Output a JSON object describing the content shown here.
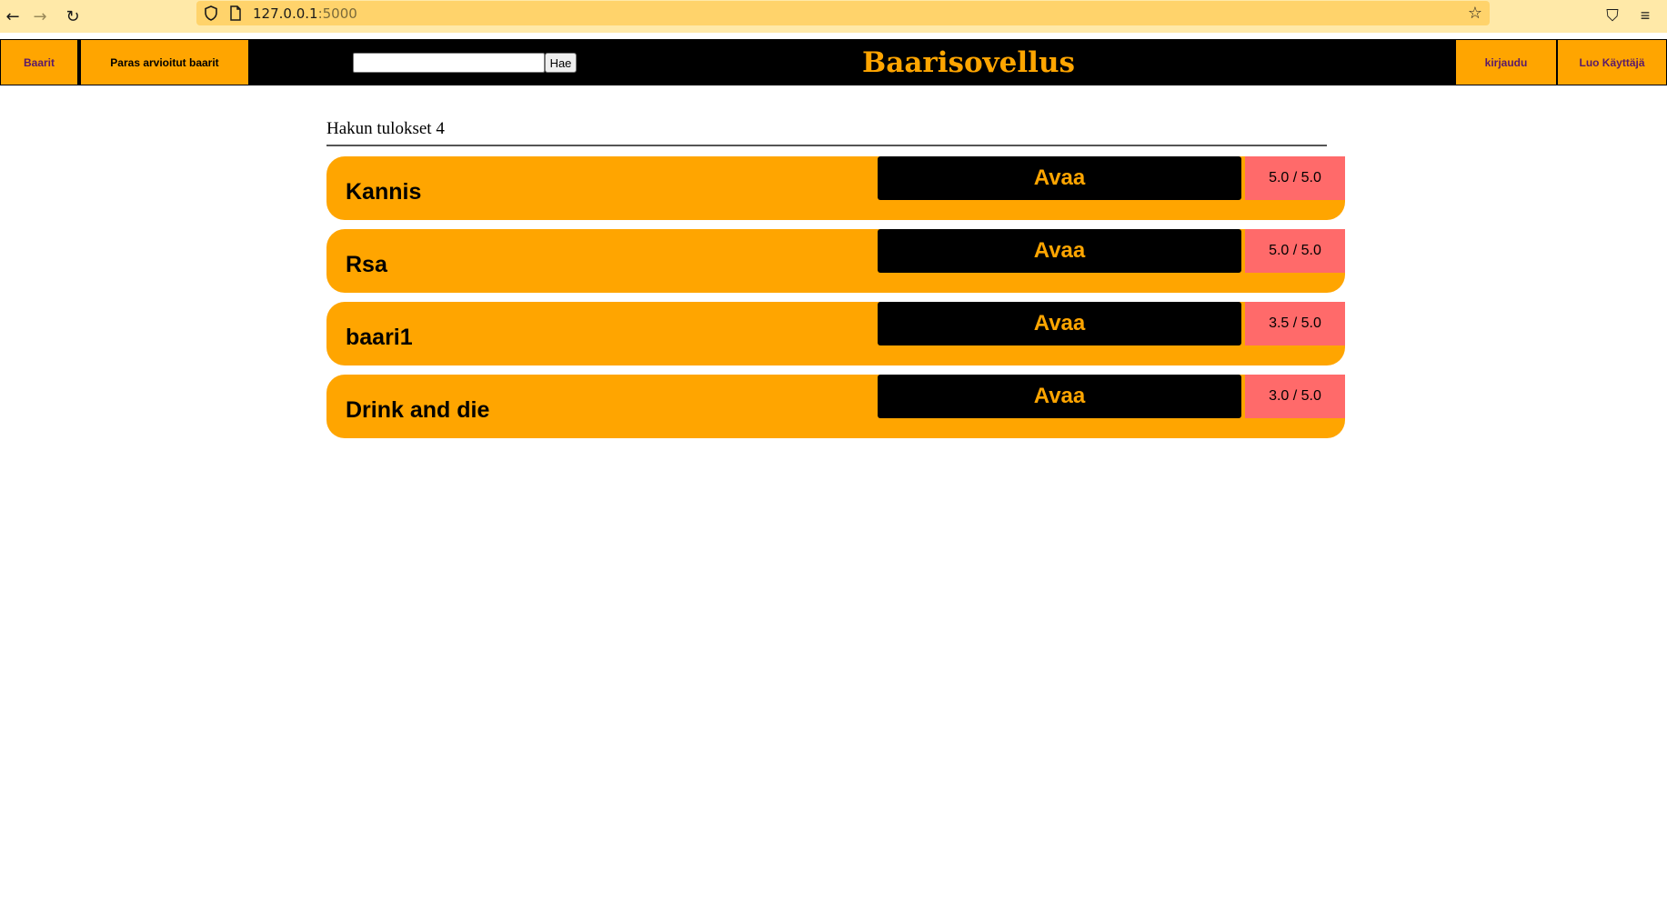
{
  "browser": {
    "url_host": "127.0.0.1",
    "url_port": ":5000",
    "back_glyph": "←",
    "forward_glyph": "→",
    "reload_glyph": "↻",
    "star_glyph": "☆",
    "pocket_glyph": "⛉",
    "menu_glyph": "≡"
  },
  "nav": {
    "bars_label": "Baarit",
    "top_rated_label": "Paras arvioitut baarit",
    "search_placeholder": "",
    "search_button": "Hae",
    "app_title": "Baarisovellus",
    "login_label": "kirjaudu",
    "register_label": "Luo Käyttäjä"
  },
  "results": {
    "heading": "Hakun tulokset 4",
    "open_label": "Avaa",
    "items": [
      {
        "name": "Kannis",
        "rating": "5.0 / 5.0"
      },
      {
        "name": "Rsa",
        "rating": "5.0 / 5.0"
      },
      {
        "name": "baari1",
        "rating": "3.5 / 5.0"
      },
      {
        "name": "Drink and die",
        "rating": "3.0 / 5.0"
      }
    ]
  },
  "colors": {
    "accent": "#ffa500",
    "nav_background": "#000000",
    "rating_background": "#ff6a6a",
    "browser_toolbar": "#ffe9a8",
    "url_bar": "#ffd36b"
  }
}
